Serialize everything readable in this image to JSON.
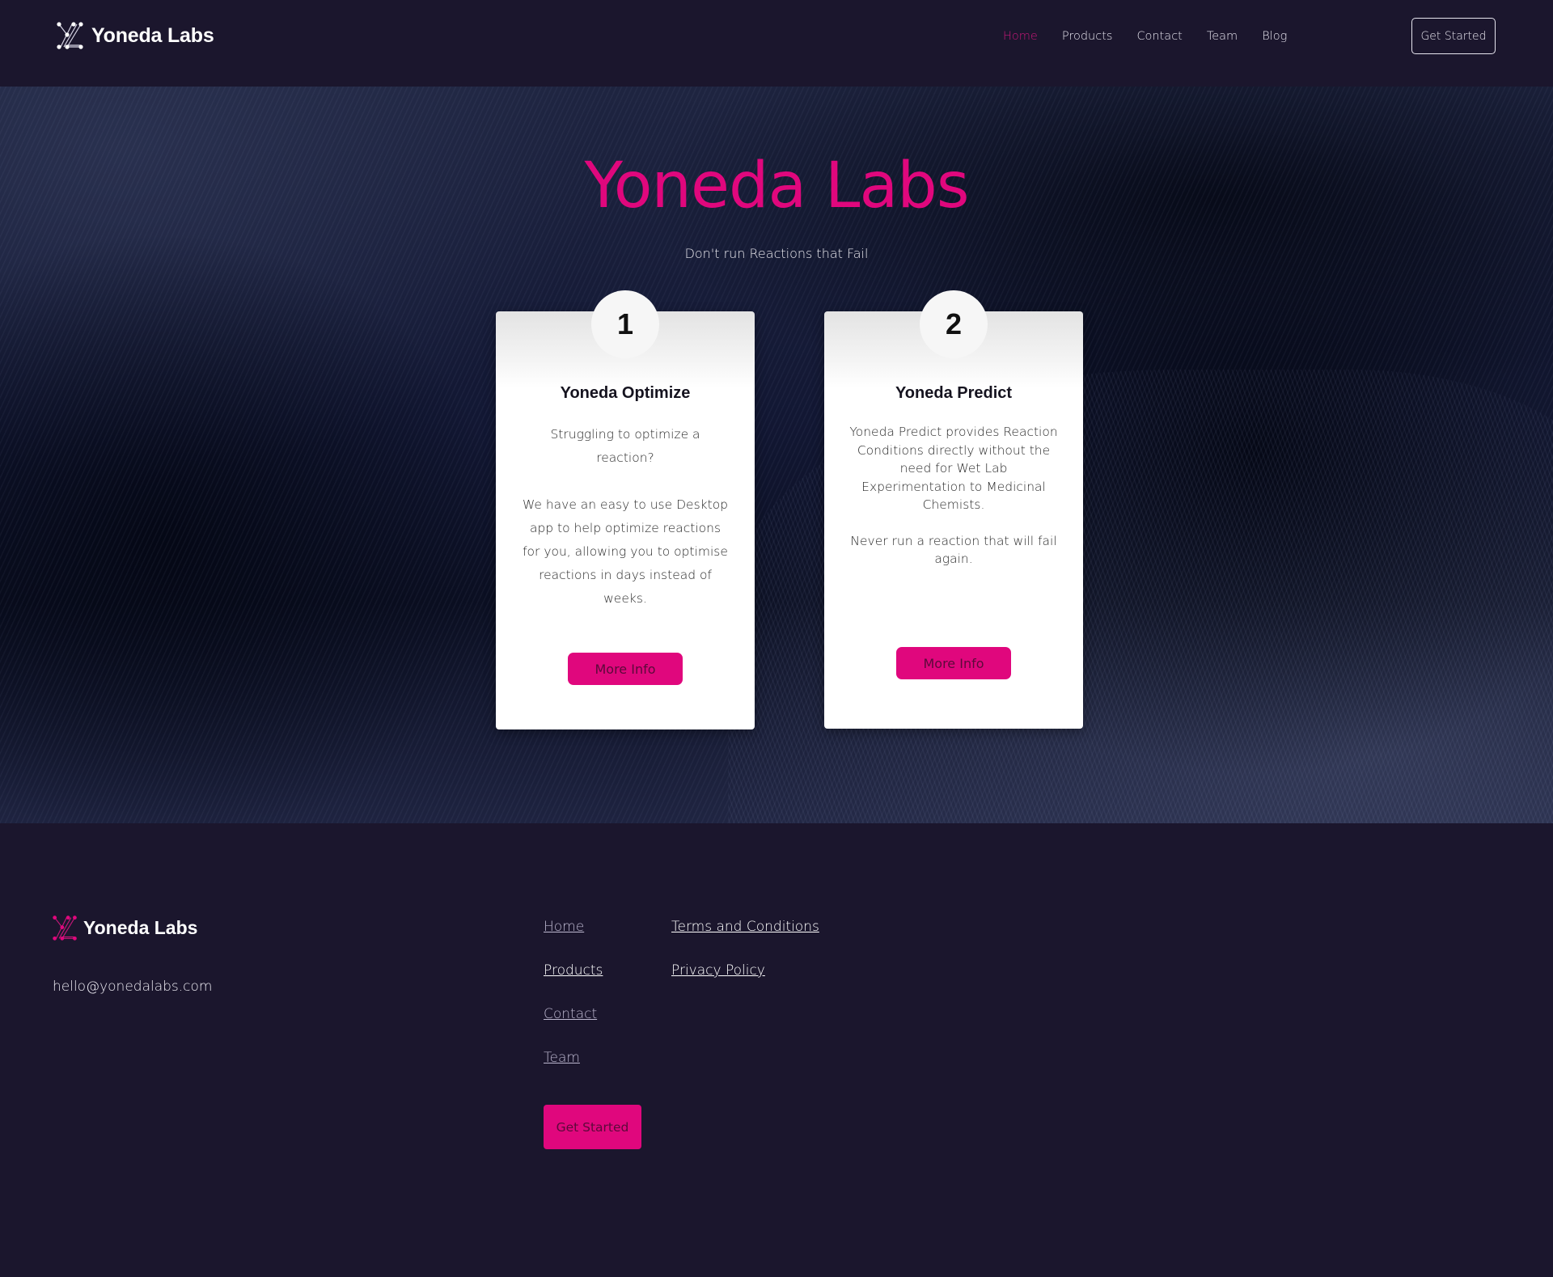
{
  "brand": {
    "name": "Yoneda Labs",
    "accent_color": "#e0077d",
    "background_color": "#1b162d"
  },
  "header": {
    "logo_icon": "yoneda-logo-icon",
    "logo_text": "Yoneda Labs",
    "nav": [
      {
        "label": "Home",
        "active": true
      },
      {
        "label": "Products",
        "active": false
      },
      {
        "label": "Contact",
        "active": false
      },
      {
        "label": "Team",
        "active": false
      },
      {
        "label": "Blog",
        "active": false
      }
    ],
    "cta_label": "Get Started"
  },
  "hero": {
    "title": "Yoneda Labs",
    "subtitle": "Don't run Reactions that Fail",
    "cards": [
      {
        "number": "1",
        "title": "Yoneda Optimize",
        "paragraphs": [
          "Struggling to optimize a reaction?",
          "We have an easy to use Desktop app to help optimize reactions for you, allowing you to optimise reactions in days instead of weeks."
        ],
        "button_label": "More Info"
      },
      {
        "number": "2",
        "title": "Yoneda Predict",
        "paragraphs": [
          "Yoneda Predict provides Reaction Conditions directly without the need for Wet Lab Experimentation to Medicinal Chemists.",
          "Never run a reaction that will fail again."
        ],
        "button_label": "More Info"
      }
    ]
  },
  "footer": {
    "logo_text": "Yoneda Labs",
    "email": "hello@yonedalabs.com",
    "links_col1": [
      "Home",
      "Products",
      "Contact",
      "Team"
    ],
    "links_col2": [
      "Terms and Conditions",
      "Privacy Policy"
    ],
    "cta_label": "Get Started"
  }
}
